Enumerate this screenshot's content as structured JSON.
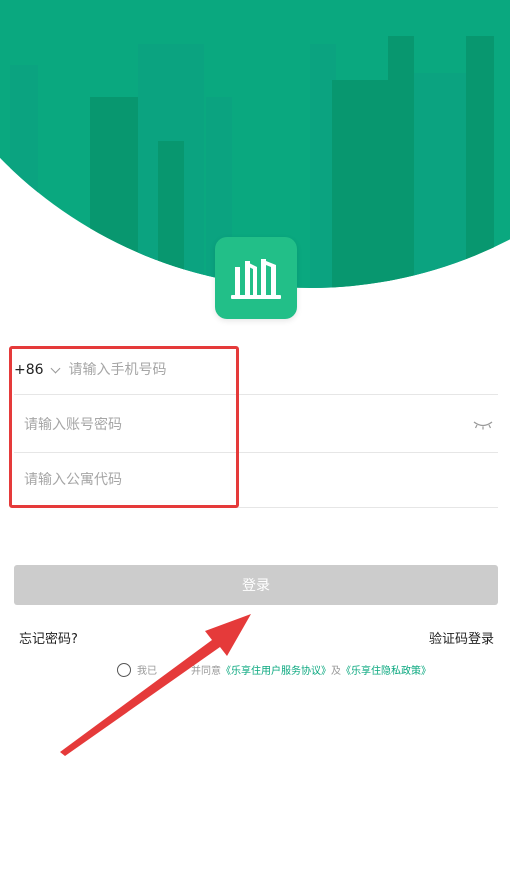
{
  "colors": {
    "brand_green": "#0aa87f",
    "logo_green": "#22bf88",
    "annotation_red": "#e53a3a",
    "button_disabled": "#cccccc"
  },
  "logo": {
    "icon": "building-icon"
  },
  "phone_row": {
    "country_code": "+86",
    "placeholder": "请输入手机号码"
  },
  "password_row": {
    "placeholder": "请输入账号密码",
    "icon": "eye-closed-icon"
  },
  "code_row": {
    "placeholder": "请输入公寓代码"
  },
  "login_button": {
    "label": "登录"
  },
  "links": {
    "forgot_password": "忘记密码?",
    "sms_login": "验证码登录"
  },
  "agreement": {
    "prefix": "我已",
    "middle": "并同意",
    "user_agreement": "《乐享住用户服务协议》",
    "and": "及",
    "privacy_policy": "《乐享住隐私政策》"
  }
}
